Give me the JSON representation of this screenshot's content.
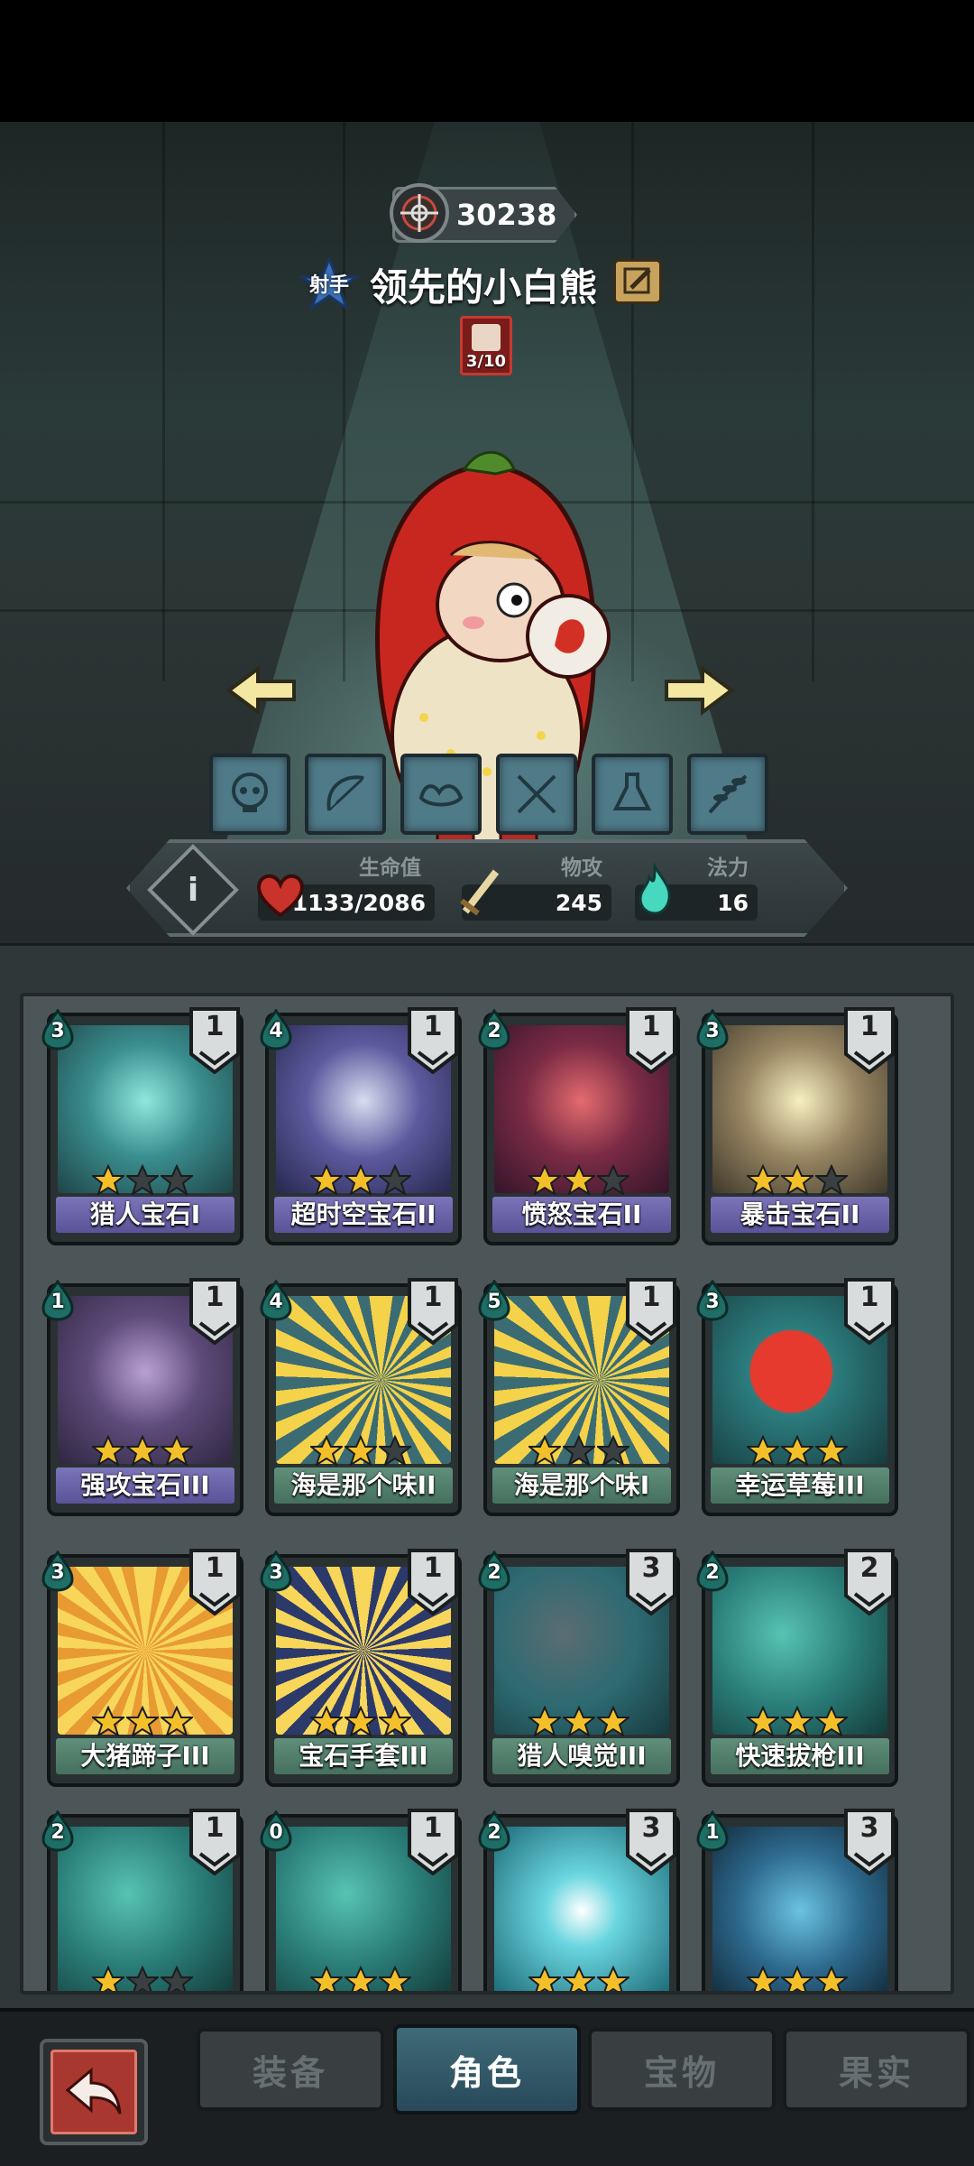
{
  "header": {
    "power": "30238",
    "class_label": "射手",
    "character_name": "领先的小白熊",
    "skill_token": "3/10"
  },
  "stats": {
    "hp_label": "生命值",
    "hp_value": "1133/2086",
    "atk_label": "物攻",
    "atk_value": "245",
    "mana_label": "法力",
    "mana_value": "16"
  },
  "cards": [
    {
      "name": "猎人宝石I",
      "cost": "3",
      "level": "1",
      "stars": 1,
      "theme": "purple"
    },
    {
      "name": "超时空宝石II",
      "cost": "4",
      "level": "1",
      "stars": 2,
      "theme": "purple"
    },
    {
      "name": "愤怒宝石II",
      "cost": "2",
      "level": "1",
      "stars": 2,
      "theme": "purple"
    },
    {
      "name": "暴击宝石II",
      "cost": "3",
      "level": "1",
      "stars": 2,
      "theme": "purple"
    },
    {
      "name": "强攻宝石III",
      "cost": "1",
      "level": "1",
      "stars": 3,
      "theme": "purple"
    },
    {
      "name": "海是那个味II",
      "cost": "4",
      "level": "1",
      "stars": 2,
      "theme": "green"
    },
    {
      "name": "海是那个味I",
      "cost": "5",
      "level": "1",
      "stars": 1,
      "theme": "green"
    },
    {
      "name": "幸运草莓III",
      "cost": "3",
      "level": "1",
      "stars": 3,
      "theme": "green"
    },
    {
      "name": "大猪蹄子III",
      "cost": "3",
      "level": "1",
      "stars": 3,
      "theme": "green"
    },
    {
      "name": "宝石手套III",
      "cost": "3",
      "level": "1",
      "stars": 3,
      "theme": "green"
    },
    {
      "name": "猎人嗅觉III",
      "cost": "2",
      "level": "3",
      "stars": 3,
      "theme": "green"
    },
    {
      "name": "快速拔枪III",
      "cost": "2",
      "level": "2",
      "stars": 3,
      "theme": "green"
    },
    {
      "name": "",
      "cost": "2",
      "level": "1",
      "stars": 1,
      "theme": "green"
    },
    {
      "name": "",
      "cost": "0",
      "level": "1",
      "stars": 3,
      "theme": "green"
    },
    {
      "name": "",
      "cost": "2",
      "level": "3",
      "stars": 3,
      "theme": "green"
    },
    {
      "name": "",
      "cost": "1",
      "level": "3",
      "stars": 3,
      "theme": "green"
    }
  ],
  "tabs": [
    {
      "label": "装备",
      "active": false
    },
    {
      "label": "角色",
      "active": true
    },
    {
      "label": "宝物",
      "active": false
    },
    {
      "label": "果实",
      "active": false
    }
  ],
  "colors": {
    "star_on": "#f4c02a",
    "star_off": "#3a3f41",
    "accent_teal": "#3f6b78",
    "back_red": "#a7372f"
  }
}
